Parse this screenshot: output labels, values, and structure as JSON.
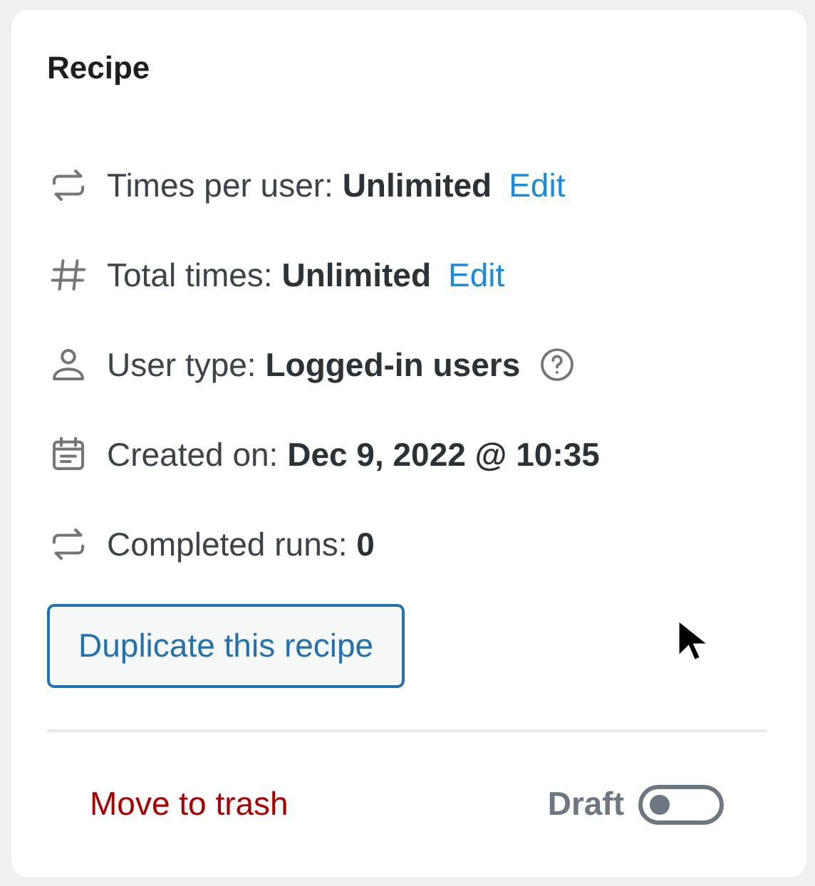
{
  "card": {
    "title": "Recipe",
    "rows": [
      {
        "kind": "repeat",
        "label": "Times per user:",
        "value": "Unlimited",
        "link": "Edit"
      },
      {
        "kind": "hash",
        "label": "Total times:",
        "value": "Unlimited",
        "link": "Edit"
      },
      {
        "kind": "user",
        "label": "User type:",
        "value": "Logged-in users",
        "help": true
      },
      {
        "kind": "calendar",
        "label": "Created on:",
        "value": "Dec 9, 2022 @ 10:35"
      },
      {
        "kind": "repeat",
        "label": "Completed runs:",
        "value": "0"
      }
    ],
    "duplicate_button": "Duplicate this recipe",
    "trash_link": "Move to trash",
    "status_toggle": {
      "label": "Draft",
      "on": false
    }
  }
}
